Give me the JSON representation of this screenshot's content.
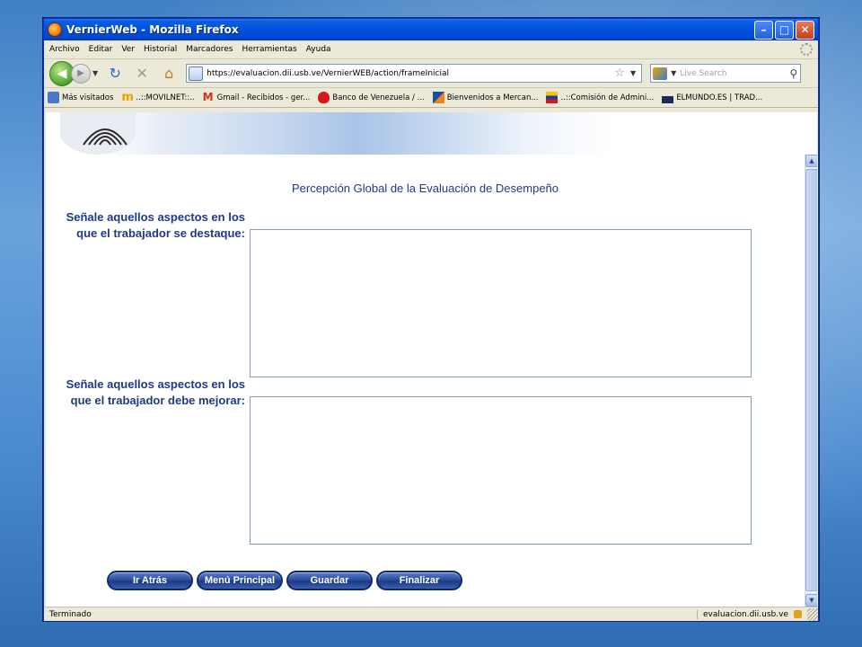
{
  "window": {
    "title": "VernierWeb - Mozilla Firefox",
    "minimize": "–",
    "maximize": "□",
    "close": "✕"
  },
  "menu": [
    "Archivo",
    "Editar",
    "Ver",
    "Historial",
    "Marcadores",
    "Herramientas",
    "Ayuda"
  ],
  "nav": {
    "url": "https://evaluacion.dii.usb.ve/VernierWEB/action/frameInicial",
    "search_placeholder": "Live Search"
  },
  "bookmarks": [
    {
      "label": "Más visitados",
      "icon": "most-visited-icon",
      "color": "#4a78c8"
    },
    {
      "label": "..::MOVILNET::..",
      "icon": "movilnet-icon",
      "color": "#f0a000"
    },
    {
      "label": "Gmail - Recibidos - ger...",
      "icon": "gmail-icon",
      "color": "#d03020"
    },
    {
      "label": "Banco de Venezuela / ...",
      "icon": "banco-icon",
      "color": "#d81818"
    },
    {
      "label": "Bienvenidos a Mercan...",
      "icon": "mercantil-icon",
      "color": "#1a4fa0"
    },
    {
      "label": "..::Comisión de Admini...",
      "icon": "venezuela-flag-icon",
      "color": "#f4c400"
    },
    {
      "label": "ELMUNDO.ES | TRAD...",
      "icon": "elmundo-icon",
      "color": "#1a2a5a"
    }
  ],
  "page": {
    "title": "Percepción Global de la Evaluación de Desempeño",
    "q1_line1": "Señale aquellos aspectos en los",
    "q1_line2": "que el trabajador se destaque:",
    "q2_line1": "Señale aquellos aspectos en los",
    "q2_line2": "que el trabajador debe mejorar:",
    "q1_value": "",
    "q2_value": ""
  },
  "actions": {
    "back": "Ir Atrás",
    "main_menu": "Menú Principal",
    "save": "Guardar",
    "finish": "Finalizar"
  },
  "status": {
    "text": "Terminado",
    "domain": "evaluacion.dii.usb.ve"
  },
  "colors": {
    "accent": "#1f3a86",
    "button": "#2d4f9e"
  }
}
